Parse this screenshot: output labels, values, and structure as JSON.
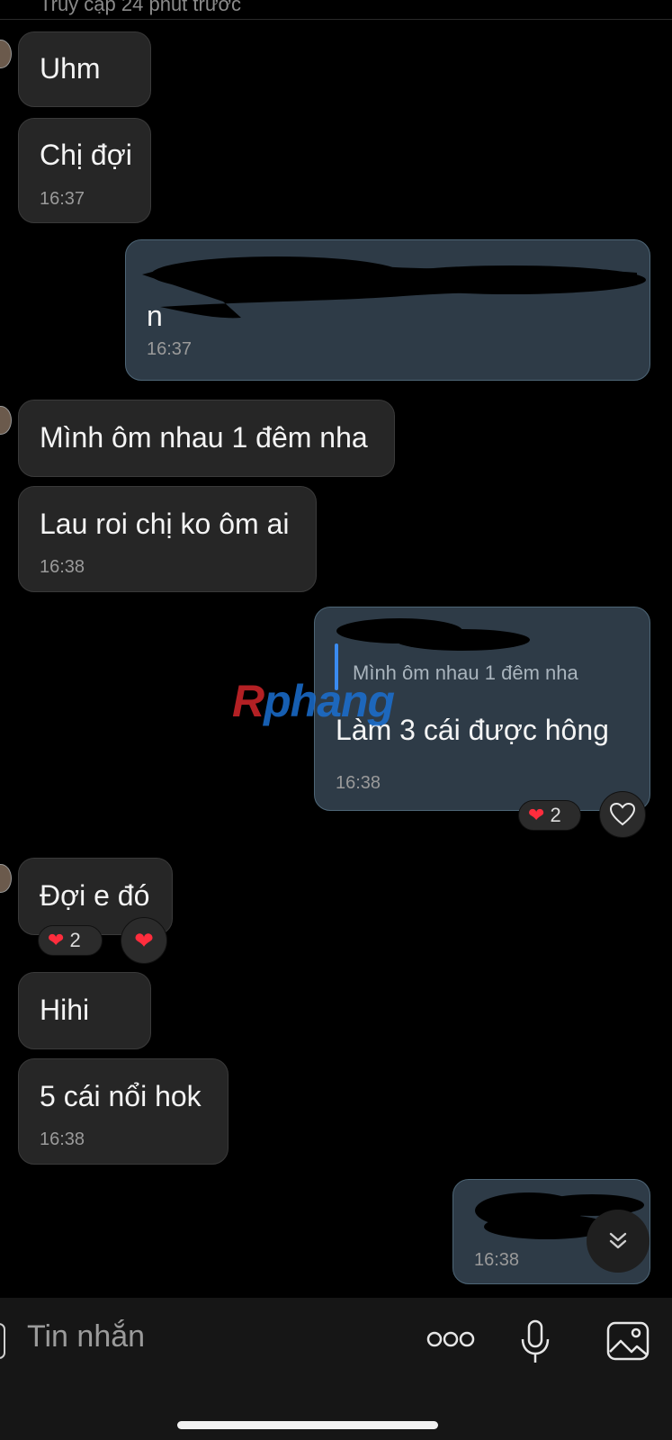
{
  "header": {
    "status": "Truy cập 24 phút trước"
  },
  "messages": [
    {
      "text": "Uhm"
    },
    {
      "text": "Chị đợi",
      "time": "16:37"
    },
    {
      "text": "n",
      "time": "16:37"
    },
    {
      "text": "Mình ôm nhau 1 đêm nha"
    },
    {
      "text": "Lau roi chị ko ôm ai",
      "time": "16:38"
    },
    {
      "reply_quote": "Mình ôm nhau 1 đêm nha",
      "text": "Làm 3 cái được hông",
      "time": "16:38",
      "reaction_count": "2"
    },
    {
      "text": "Đợi e đó",
      "reaction_count": "2"
    },
    {
      "text": "Hihi"
    },
    {
      "text": "5 cái nổi hok",
      "time": "16:38"
    },
    {
      "text": "",
      "time": "16:38"
    }
  ],
  "watermark": {
    "r": "R",
    "rest": "phang"
  },
  "composer": {
    "placeholder": "Tin nhắn"
  },
  "icons": {
    "reaction_heart": "heart-icon",
    "like": "heart-outline-icon",
    "more": "more-dots-icon",
    "mic": "microphone-icon",
    "image": "image-icon",
    "scroll_down": "chevron-double-down-icon"
  },
  "colors": {
    "background": "#000000",
    "incoming_bubble": "#262626",
    "outgoing_bubble": "#2e3b47",
    "heart": "#ff2d3d"
  }
}
